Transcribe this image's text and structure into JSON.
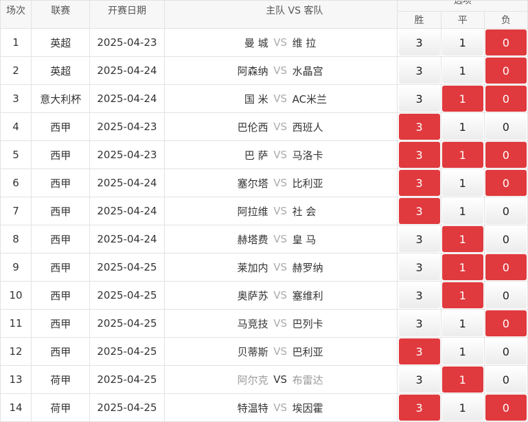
{
  "headers": {
    "index": "场次",
    "league": "联赛",
    "date": "开赛日期",
    "home": "主队",
    "vs": "VS",
    "away": "客队",
    "options": "选项",
    "win": "胜",
    "draw": "平",
    "lose": "负"
  },
  "colors": {
    "selected": "#e03a3e",
    "unselected": "#f2f2f2"
  },
  "rows": [
    {
      "index": "1",
      "league": "英超",
      "date": "2025-04-23",
      "home": "曼 城",
      "vs": "VS",
      "away": "维 拉",
      "win": "3",
      "draw": "1",
      "lose": "0",
      "sel": [
        false,
        false,
        true
      ],
      "dim": false
    },
    {
      "index": "2",
      "league": "英超",
      "date": "2025-04-24",
      "home": "阿森纳",
      "vs": "VS",
      "away": "水晶宫",
      "win": "3",
      "draw": "1",
      "lose": "0",
      "sel": [
        false,
        false,
        true
      ],
      "dim": false
    },
    {
      "index": "3",
      "league": "意大利杯",
      "date": "2025-04-24",
      "home": "国 米",
      "vs": "VS",
      "away": "AC米兰",
      "win": "3",
      "draw": "1",
      "lose": "0",
      "sel": [
        false,
        true,
        true
      ],
      "dim": false
    },
    {
      "index": "4",
      "league": "西甲",
      "date": "2025-04-23",
      "home": "巴伦西",
      "vs": "VS",
      "away": "西班人",
      "win": "3",
      "draw": "1",
      "lose": "0",
      "sel": [
        true,
        false,
        false
      ],
      "dim": false
    },
    {
      "index": "5",
      "league": "西甲",
      "date": "2025-04-23",
      "home": "巴 萨",
      "vs": "VS",
      "away": "马洛卡",
      "win": "3",
      "draw": "1",
      "lose": "0",
      "sel": [
        true,
        true,
        true
      ],
      "dim": false
    },
    {
      "index": "6",
      "league": "西甲",
      "date": "2025-04-24",
      "home": "塞尔塔",
      "vs": "VS",
      "away": "比利亚",
      "win": "3",
      "draw": "1",
      "lose": "0",
      "sel": [
        true,
        false,
        true
      ],
      "dim": false
    },
    {
      "index": "7",
      "league": "西甲",
      "date": "2025-04-24",
      "home": "阿拉维",
      "vs": "VS",
      "away": "社 会",
      "win": "3",
      "draw": "1",
      "lose": "0",
      "sel": [
        true,
        false,
        false
      ],
      "dim": false
    },
    {
      "index": "8",
      "league": "西甲",
      "date": "2025-04-24",
      "home": "赫塔费",
      "vs": "VS",
      "away": "皇 马",
      "win": "3",
      "draw": "1",
      "lose": "0",
      "sel": [
        false,
        true,
        false
      ],
      "dim": false
    },
    {
      "index": "9",
      "league": "西甲",
      "date": "2025-04-25",
      "home": "莱加内",
      "vs": "VS",
      "away": "赫罗纳",
      "win": "3",
      "draw": "1",
      "lose": "0",
      "sel": [
        false,
        true,
        true
      ],
      "dim": false
    },
    {
      "index": "10",
      "league": "西甲",
      "date": "2025-04-25",
      "home": "奥萨苏",
      "vs": "VS",
      "away": "塞维利",
      "win": "3",
      "draw": "1",
      "lose": "0",
      "sel": [
        false,
        true,
        false
      ],
      "dim": false
    },
    {
      "index": "11",
      "league": "西甲",
      "date": "2025-04-25",
      "home": "马竞技",
      "vs": "VS",
      "away": "巴列卡",
      "win": "3",
      "draw": "1",
      "lose": "0",
      "sel": [
        false,
        false,
        true
      ],
      "dim": false
    },
    {
      "index": "12",
      "league": "西甲",
      "date": "2025-04-25",
      "home": "贝蒂斯",
      "vs": "VS",
      "away": "巴利亚",
      "win": "3",
      "draw": "1",
      "lose": "0",
      "sel": [
        true,
        false,
        false
      ],
      "dim": false
    },
    {
      "index": "13",
      "league": "荷甲",
      "date": "2025-04-25",
      "home": "阿尔克",
      "vs": "VS",
      "away": "布雷达",
      "win": "3",
      "draw": "1",
      "lose": "0",
      "sel": [
        false,
        true,
        false
      ],
      "dim": true
    },
    {
      "index": "14",
      "league": "荷甲",
      "date": "2025-04-25",
      "home": "特温特",
      "vs": "VS",
      "away": "埃因霍",
      "win": "3",
      "draw": "1",
      "lose": "0",
      "sel": [
        true,
        false,
        true
      ],
      "dim": false
    }
  ]
}
